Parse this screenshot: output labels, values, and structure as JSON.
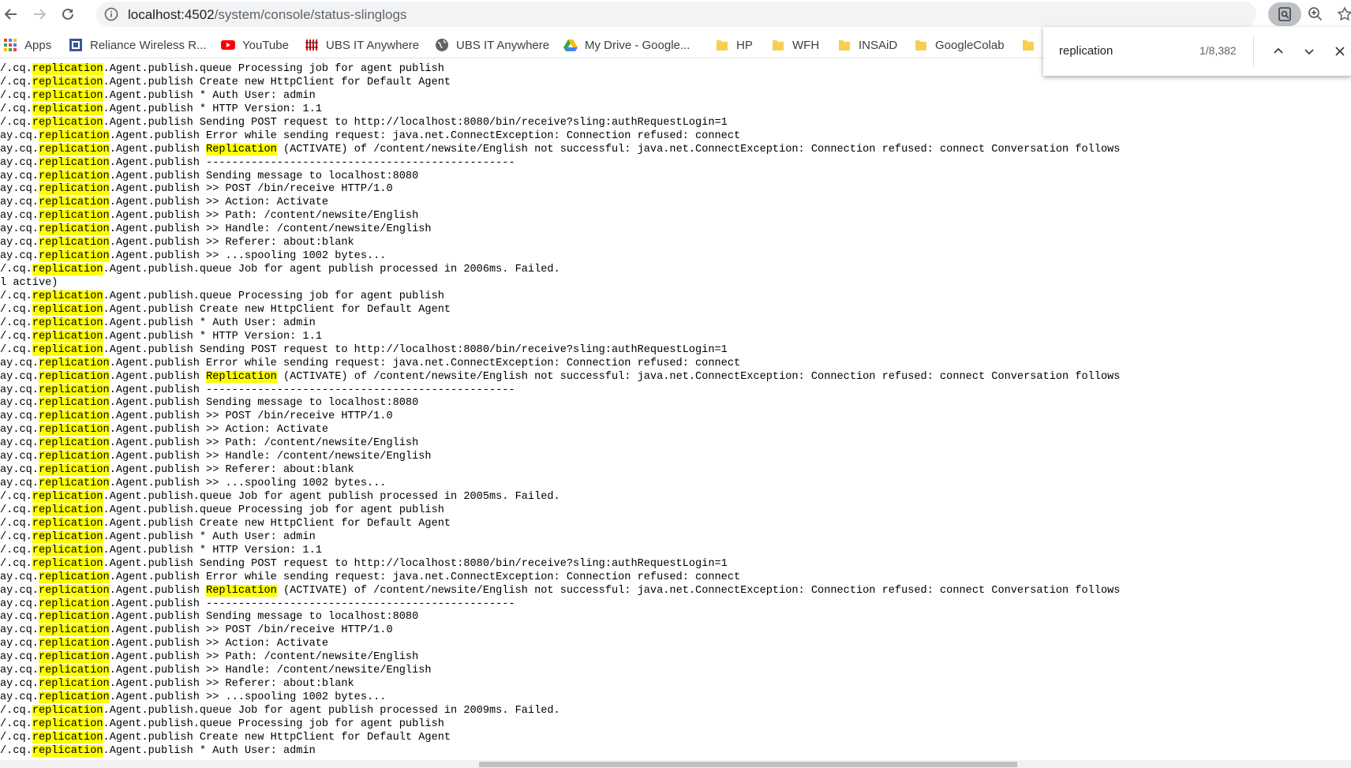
{
  "browser": {
    "url_host": "localhost:4502",
    "url_path": "/system/console/status-slinglogs"
  },
  "bookmarks": [
    {
      "label": "Apps",
      "icon": "apps-grid-icon",
      "color": "#4285f4"
    },
    {
      "label": "Reliance Wireless R...",
      "icon": "reliance-icon",
      "color": "#3b5998"
    },
    {
      "label": "YouTube",
      "icon": "youtube-icon",
      "color": "#ff0000"
    },
    {
      "label": "UBS IT Anywhere",
      "icon": "ubs-icon",
      "color": "#e60000"
    },
    {
      "label": "UBS IT Anywhere",
      "icon": "globe-icon",
      "color": "#5f6368"
    },
    {
      "label": "My Drive - Google...",
      "icon": "google-drive-icon",
      "color": "#34a853"
    },
    {
      "label": "HP",
      "icon": "folder-icon",
      "color": "#f9ce50"
    },
    {
      "label": "WFH",
      "icon": "folder-icon",
      "color": "#f9ce50"
    },
    {
      "label": "INSAiD",
      "icon": "folder-icon",
      "color": "#f9ce50"
    },
    {
      "label": "GoogleColab",
      "icon": "folder-icon",
      "color": "#f9ce50"
    },
    {
      "label": "",
      "icon": "folder-icon",
      "color": "#f9ce50"
    }
  ],
  "find": {
    "query": "replication",
    "count": "1/8,382"
  },
  "colors": {
    "highlight": "#ffff00",
    "omnibox_bg": "#f1f3f4"
  },
  "log_lines": [
    {
      "prefix": "/.cq.",
      "hl": "replication",
      "rest": ".Agent.publish.queue Processing job for agent publish"
    },
    {
      "prefix": "/.cq.",
      "hl": "replication",
      "rest": ".Agent.publish Create new HttpClient for Default Agent"
    },
    {
      "prefix": "/.cq.",
      "hl": "replication",
      "rest": ".Agent.publish * Auth User: admin"
    },
    {
      "prefix": "/.cq.",
      "hl": "replication",
      "rest": ".Agent.publish * HTTP Version: 1.1"
    },
    {
      "prefix": "/.cq.",
      "hl": "replication",
      "rest": ".Agent.publish Sending POST request to http://localhost:8080/bin/receive?sling:authRequestLogin=1"
    },
    {
      "prefix": "ay.cq.",
      "hl": "replication",
      "rest": ".Agent.publish Error while sending request: java.net.ConnectException: Connection refused: connect"
    },
    {
      "prefix": "ay.cq.",
      "hl": "replication",
      "rest": ".Agent.publish ",
      "hl2": "Replication",
      "rest2": " (ACTIVATE) of /content/newsite/English not successful: java.net.ConnectException: Connection refused: connect Conversation follows"
    },
    {
      "prefix": "ay.cq.",
      "hl": "replication",
      "rest": ".Agent.publish ------------------------------------------------"
    },
    {
      "prefix": "ay.cq.",
      "hl": "replication",
      "rest": ".Agent.publish Sending message to localhost:8080"
    },
    {
      "prefix": "ay.cq.",
      "hl": "replication",
      "rest": ".Agent.publish >> POST /bin/receive HTTP/1.0"
    },
    {
      "prefix": "ay.cq.",
      "hl": "replication",
      "rest": ".Agent.publish >> Action: Activate"
    },
    {
      "prefix": "ay.cq.",
      "hl": "replication",
      "rest": ".Agent.publish >> Path: /content/newsite/English"
    },
    {
      "prefix": "ay.cq.",
      "hl": "replication",
      "rest": ".Agent.publish >> Handle: /content/newsite/English"
    },
    {
      "prefix": "ay.cq.",
      "hl": "replication",
      "rest": ".Agent.publish >> Referer: about:blank"
    },
    {
      "prefix": "ay.cq.",
      "hl": "replication",
      "rest": ".Agent.publish >> ...spooling 1002 bytes..."
    },
    {
      "prefix": "/.cq.",
      "hl": "replication",
      "rest": ".Agent.publish.queue Job for agent publish processed in 2006ms. Failed."
    },
    {
      "prefix": "l active)",
      "hl": "",
      "rest": ""
    },
    {
      "prefix": "/.cq.",
      "hl": "replication",
      "rest": ".Agent.publish.queue Processing job for agent publish"
    },
    {
      "prefix": "/.cq.",
      "hl": "replication",
      "rest": ".Agent.publish Create new HttpClient for Default Agent"
    },
    {
      "prefix": "/.cq.",
      "hl": "replication",
      "rest": ".Agent.publish * Auth User: admin"
    },
    {
      "prefix": "/.cq.",
      "hl": "replication",
      "rest": ".Agent.publish * HTTP Version: 1.1"
    },
    {
      "prefix": "/.cq.",
      "hl": "replication",
      "rest": ".Agent.publish Sending POST request to http://localhost:8080/bin/receive?sling:authRequestLogin=1"
    },
    {
      "prefix": "ay.cq.",
      "hl": "replication",
      "rest": ".Agent.publish Error while sending request: java.net.ConnectException: Connection refused: connect"
    },
    {
      "prefix": "ay.cq.",
      "hl": "replication",
      "rest": ".Agent.publish ",
      "hl2": "Replication",
      "rest2": " (ACTIVATE) of /content/newsite/English not successful: java.net.ConnectException: Connection refused: connect Conversation follows"
    },
    {
      "prefix": "ay.cq.",
      "hl": "replication",
      "rest": ".Agent.publish ------------------------------------------------"
    },
    {
      "prefix": "ay.cq.",
      "hl": "replication",
      "rest": ".Agent.publish Sending message to localhost:8080"
    },
    {
      "prefix": "ay.cq.",
      "hl": "replication",
      "rest": ".Agent.publish >> POST /bin/receive HTTP/1.0"
    },
    {
      "prefix": "ay.cq.",
      "hl": "replication",
      "rest": ".Agent.publish >> Action: Activate"
    },
    {
      "prefix": "ay.cq.",
      "hl": "replication",
      "rest": ".Agent.publish >> Path: /content/newsite/English"
    },
    {
      "prefix": "ay.cq.",
      "hl": "replication",
      "rest": ".Agent.publish >> Handle: /content/newsite/English"
    },
    {
      "prefix": "ay.cq.",
      "hl": "replication",
      "rest": ".Agent.publish >> Referer: about:blank"
    },
    {
      "prefix": "ay.cq.",
      "hl": "replication",
      "rest": ".Agent.publish >> ...spooling 1002 bytes..."
    },
    {
      "prefix": "/.cq.",
      "hl": "replication",
      "rest": ".Agent.publish.queue Job for agent publish processed in 2005ms. Failed."
    },
    {
      "prefix": "/.cq.",
      "hl": "replication",
      "rest": ".Agent.publish.queue Processing job for agent publish"
    },
    {
      "prefix": "/.cq.",
      "hl": "replication",
      "rest": ".Agent.publish Create new HttpClient for Default Agent"
    },
    {
      "prefix": "/.cq.",
      "hl": "replication",
      "rest": ".Agent.publish * Auth User: admin"
    },
    {
      "prefix": "/.cq.",
      "hl": "replication",
      "rest": ".Agent.publish * HTTP Version: 1.1"
    },
    {
      "prefix": "/.cq.",
      "hl": "replication",
      "rest": ".Agent.publish Sending POST request to http://localhost:8080/bin/receive?sling:authRequestLogin=1"
    },
    {
      "prefix": "ay.cq.",
      "hl": "replication",
      "rest": ".Agent.publish Error while sending request: java.net.ConnectException: Connection refused: connect"
    },
    {
      "prefix": "ay.cq.",
      "hl": "replication",
      "rest": ".Agent.publish ",
      "hl2": "Replication",
      "rest2": " (ACTIVATE) of /content/newsite/English not successful: java.net.ConnectException: Connection refused: connect Conversation follows"
    },
    {
      "prefix": "ay.cq.",
      "hl": "replication",
      "rest": ".Agent.publish ------------------------------------------------"
    },
    {
      "prefix": "ay.cq.",
      "hl": "replication",
      "rest": ".Agent.publish Sending message to localhost:8080"
    },
    {
      "prefix": "ay.cq.",
      "hl": "replication",
      "rest": ".Agent.publish >> POST /bin/receive HTTP/1.0"
    },
    {
      "prefix": "ay.cq.",
      "hl": "replication",
      "rest": ".Agent.publish >> Action: Activate"
    },
    {
      "prefix": "ay.cq.",
      "hl": "replication",
      "rest": ".Agent.publish >> Path: /content/newsite/English"
    },
    {
      "prefix": "ay.cq.",
      "hl": "replication",
      "rest": ".Agent.publish >> Handle: /content/newsite/English"
    },
    {
      "prefix": "ay.cq.",
      "hl": "replication",
      "rest": ".Agent.publish >> Referer: about:blank"
    },
    {
      "prefix": "ay.cq.",
      "hl": "replication",
      "rest": ".Agent.publish >> ...spooling 1002 bytes..."
    },
    {
      "prefix": "/.cq.",
      "hl": "replication",
      "rest": ".Agent.publish.queue Job for agent publish processed in 2009ms. Failed."
    },
    {
      "prefix": "/.cq.",
      "hl": "replication",
      "rest": ".Agent.publish.queue Processing job for agent publish"
    },
    {
      "prefix": "/.cq.",
      "hl": "replication",
      "rest": ".Agent.publish Create new HttpClient for Default Agent"
    },
    {
      "prefix": "/.cq.",
      "hl": "replication",
      "rest": ".Agent.publish * Auth User: admin"
    }
  ]
}
